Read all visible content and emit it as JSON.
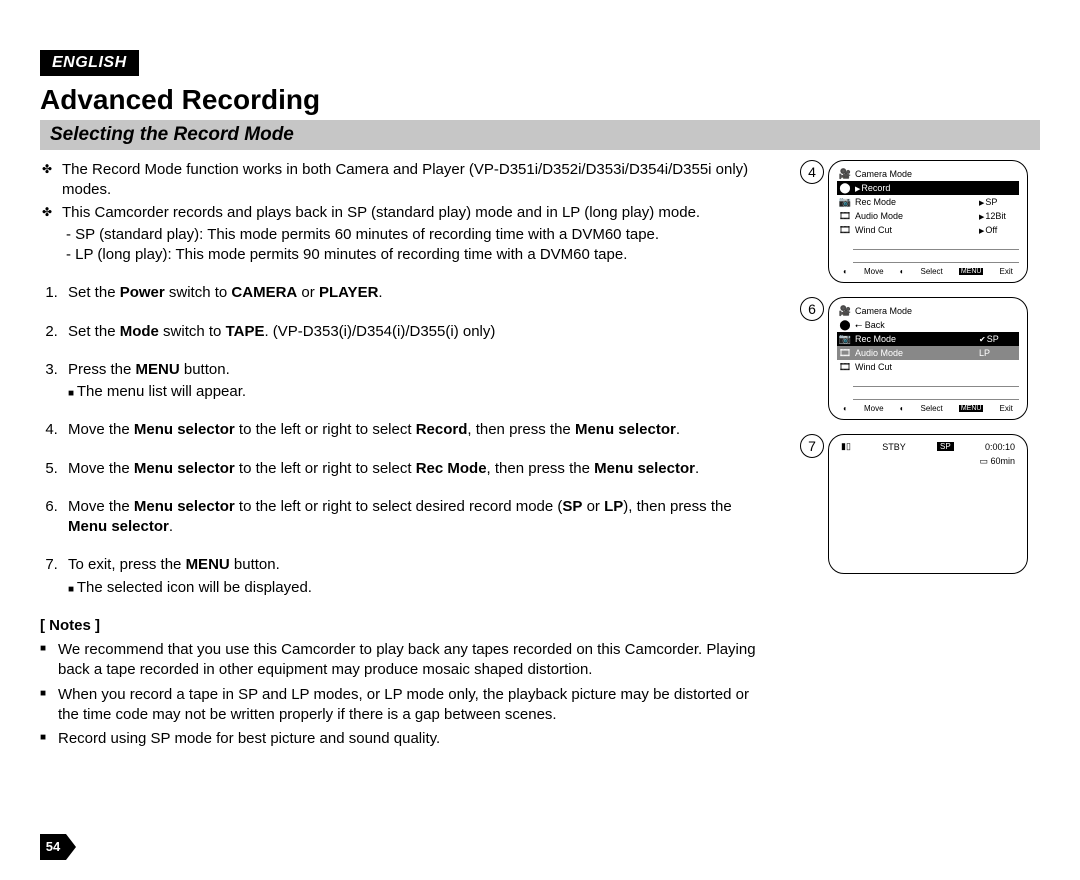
{
  "lang": "ENGLISH",
  "title": "Advanced Recording",
  "section": "Selecting the Record Mode",
  "intro": {
    "b1": "The Record Mode function works in both Camera and Player (VP-D351i/D352i/D353i/D354i/D355i only) modes.",
    "b2": "This Camcorder records and plays back in SP (standard play) mode and in LP (long play) mode.",
    "b2a": "SP (standard play): This mode permits 60 minutes of recording time with a DVM60 tape.",
    "b2b": "LP (long play): This mode permits 90 minutes of recording time with a DVM60 tape."
  },
  "steps": {
    "s1a": "Set the ",
    "s1b": "Power",
    "s1c": " switch to ",
    "s1d": "CAMERA",
    "s1e": " or ",
    "s1f": "PLAYER",
    "s1g": ".",
    "s2a": "Set the ",
    "s2b": "Mode",
    "s2c": " switch to ",
    "s2d": "TAPE",
    "s2e": ". (VP-D353(i)/D354(i)/D355(i) only)",
    "s3a": "Press the ",
    "s3b": "MENU",
    "s3c": " button.",
    "s3sub": "The menu list will appear.",
    "s4a": "Move the ",
    "s4b": "Menu selector",
    "s4c": " to the left or right to select ",
    "s4d": "Record",
    "s4e": ", then press the ",
    "s4f": "Menu selector",
    "s4g": ".",
    "s5a": "Move the ",
    "s5b": "Menu selector",
    "s5c": " to the left or right to select ",
    "s5d": "Rec Mode",
    "s5e": ", then press the ",
    "s5f": "Menu selector",
    "s5g": ".",
    "s6a": "Move the ",
    "s6b": "Menu selector",
    "s6c": " to the left or right to select desired record mode (",
    "s6d": "SP",
    "s6e": " or ",
    "s6f": "LP",
    "s6g": "), then press the ",
    "s6h": "Menu selector",
    "s6i": ".",
    "s7a": "To exit, press the ",
    "s7b": "MENU",
    "s7c": " button.",
    "s7sub": "The selected icon will be displayed."
  },
  "notes_label": "[ Notes ]",
  "notes": {
    "n1": "We recommend that you use this Camcorder to play back any tapes recorded on this Camcorder. Playing back a tape recorded in other equipment may produce mosaic shaped distortion.",
    "n2": "When you record a tape in SP and LP modes, or LP mode only, the playback picture may be distorted or the time code may not be written properly if there is a gap between scenes.",
    "n3": "Record using SP mode for best picture and sound quality."
  },
  "fig": {
    "num4": "4",
    "num6": "6",
    "num7": "7",
    "cameraMode": "Camera Mode",
    "record": "Record",
    "recMode": "Rec Mode",
    "audioMode": "Audio Mode",
    "windCut": "Wind Cut",
    "back": "Back",
    "sp": "SP",
    "lp": "LP",
    "bit12": "12Bit",
    "off": "Off",
    "move": "Move",
    "select": "Select",
    "menu": "MENU",
    "exit": "Exit",
    "stby": "STBY",
    "time": "0:00:10",
    "remain": "60min"
  },
  "page_number": "54"
}
